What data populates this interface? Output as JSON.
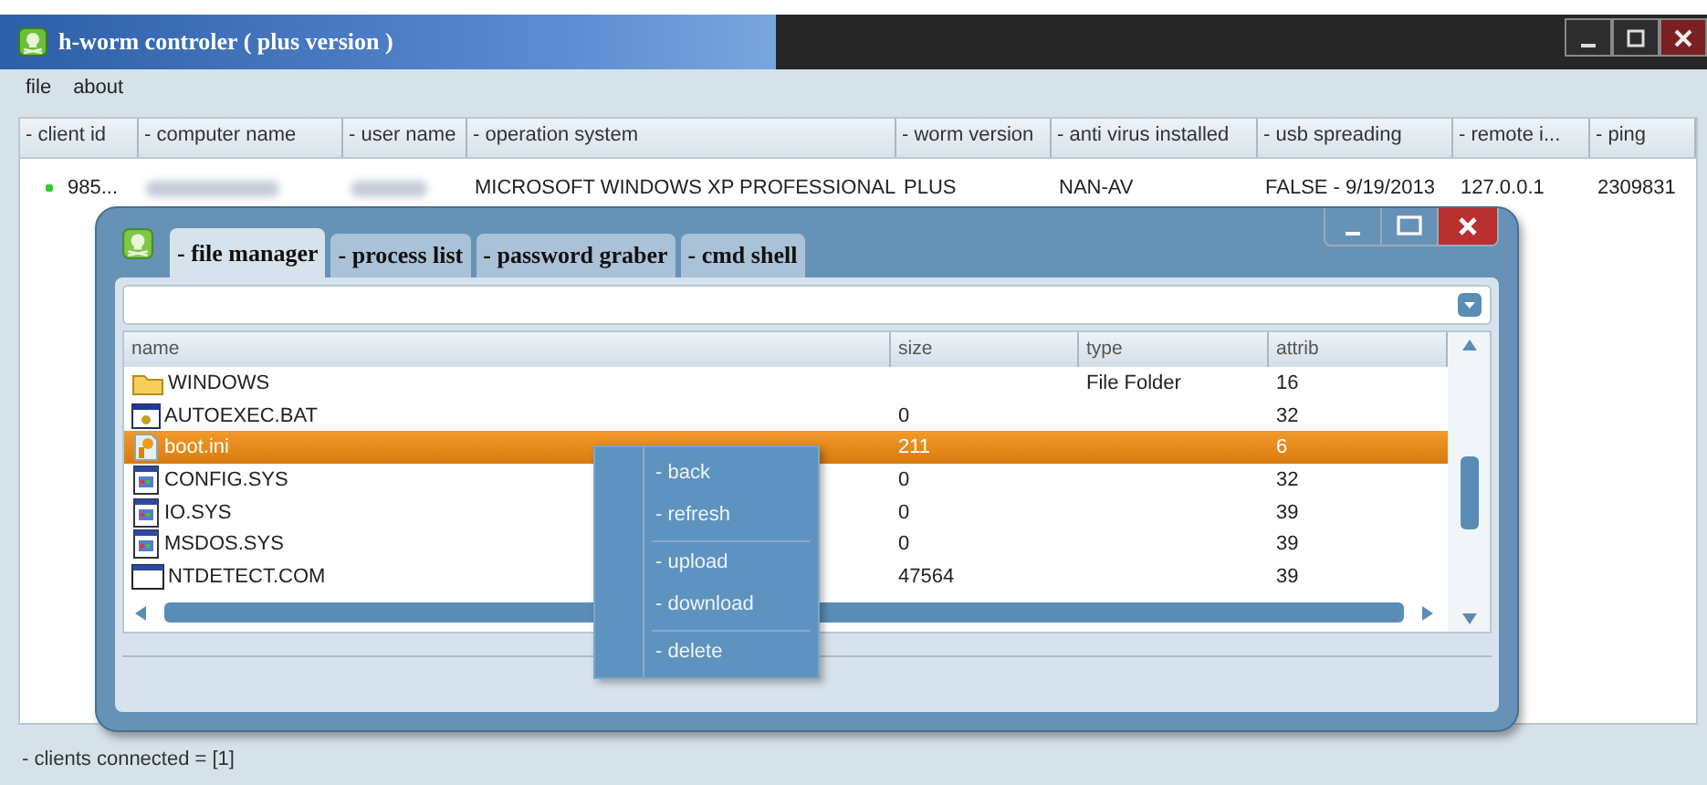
{
  "window": {
    "title": "h-worm controler ( plus version )"
  },
  "menu": [
    {
      "label": "file"
    },
    {
      "label": "about"
    }
  ],
  "clients": {
    "columns": [
      "- client id",
      "- computer name",
      "- user name",
      "- operation system",
      "- worm version",
      "- anti virus installed",
      "- usb spreading",
      "- remote i...",
      "- ping"
    ],
    "rows": [
      {
        "cells": [
          {
            "kind": "text",
            "text": "985..."
          },
          {
            "kind": "blurred"
          },
          {
            "kind": "blurred"
          },
          {
            "kind": "text",
            "text": "MICROSOFT WINDOWS XP PROFESSIONAL"
          },
          {
            "kind": "text",
            "text": "PLUS"
          },
          {
            "kind": "text",
            "text": "NAN-AV"
          },
          {
            "kind": "text",
            "text": "FALSE - 9/19/2013"
          },
          {
            "kind": "text",
            "text": "127.0.0.1"
          },
          {
            "kind": "text",
            "text": "2309831"
          }
        ]
      }
    ]
  },
  "status_bar": "- clients connected = [1]",
  "tool_window": {
    "tabs": [
      {
        "label": "- file manager",
        "selected": true
      },
      {
        "label": "- process list",
        "selected": false
      },
      {
        "label": "- password graber",
        "selected": false
      },
      {
        "label": "- cmd shell",
        "selected": false
      }
    ],
    "file_manager": {
      "columns": [
        "name",
        "size",
        "type",
        "attrib"
      ],
      "rows": [
        {
          "kind": "folder",
          "name": "WINDOWS",
          "size": "",
          "type": "File Folder",
          "attrib": "16",
          "selected": false
        },
        {
          "kind": "batch",
          "name": "AUTOEXEC.BAT",
          "size": "0",
          "type": "",
          "attrib": "32",
          "selected": false
        },
        {
          "kind": "settings",
          "name": "boot.ini",
          "size": "211",
          "type": "",
          "attrib": "6",
          "selected": true
        },
        {
          "kind": "system",
          "name": "CONFIG.SYS",
          "size": "0",
          "type": "",
          "attrib": "32",
          "selected": false
        },
        {
          "kind": "system",
          "name": "IO.SYS",
          "size": "0",
          "type": "",
          "attrib": "39",
          "selected": false
        },
        {
          "kind": "system",
          "name": "MSDOS.SYS",
          "size": "0",
          "type": "",
          "attrib": "39",
          "selected": false
        },
        {
          "kind": "program",
          "name": "NTDETECT.COM",
          "size": "47564",
          "type": "",
          "attrib": "39",
          "selected": false
        }
      ]
    },
    "context_menu": [
      [
        "- back",
        "- refresh"
      ],
      [
        "- upload",
        "- download"
      ],
      [
        "- delete"
      ]
    ]
  }
}
